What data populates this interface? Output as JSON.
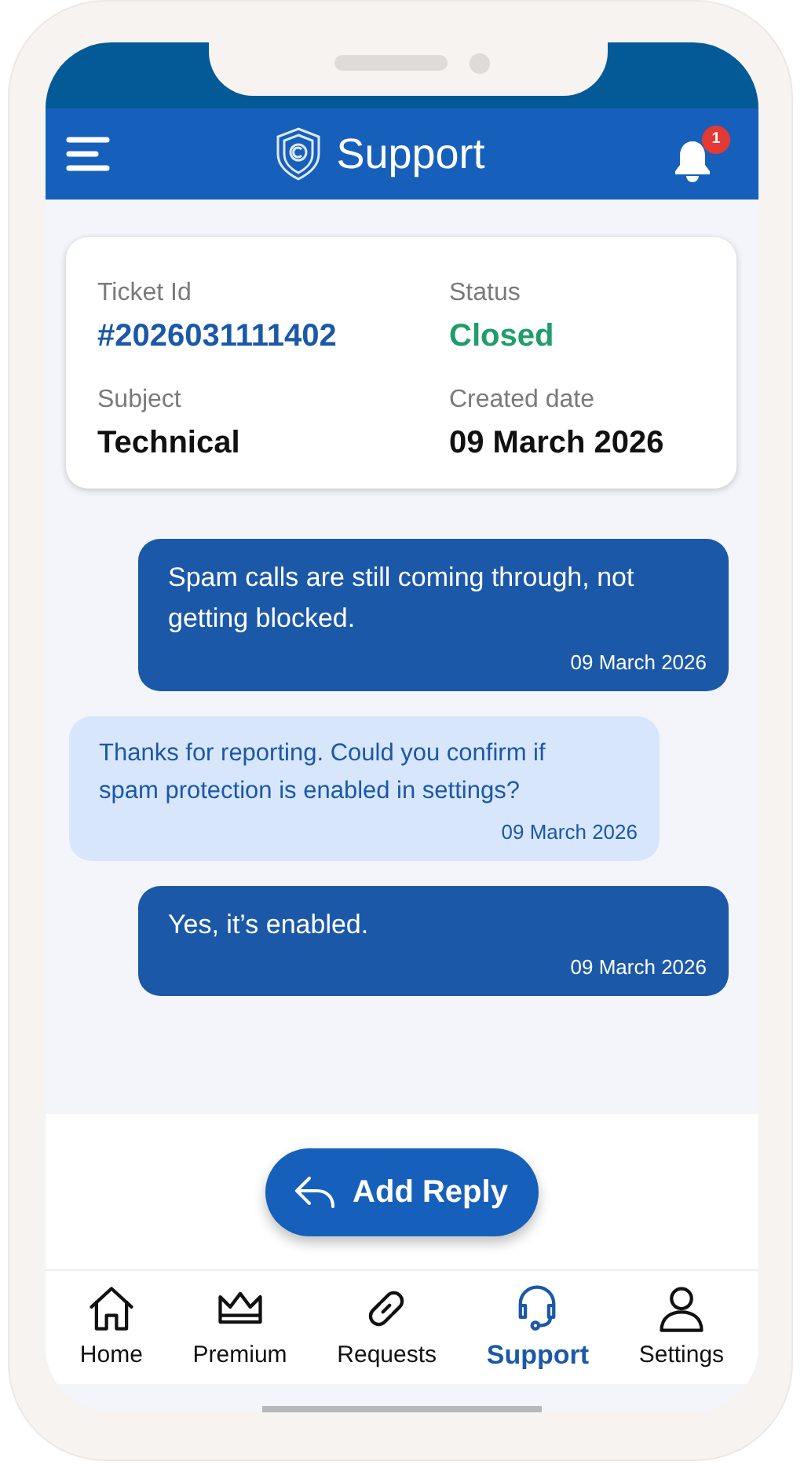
{
  "header": {
    "title": "Support",
    "notification_count": "1"
  },
  "ticket": {
    "fields": [
      {
        "label": "Ticket Id",
        "value": "#2026031111402",
        "kind": "id"
      },
      {
        "label": "Status",
        "value": "Closed",
        "kind": "status"
      },
      {
        "label": "Subject",
        "value": "Technical",
        "kind": "plain"
      },
      {
        "label": "Created date",
        "value": "09 March 2026",
        "kind": "plain"
      }
    ]
  },
  "messages": [
    {
      "kind": "sent",
      "text": "Spam calls are still coming through, not getting blocked.",
      "date": "09 March 2026"
    },
    {
      "kind": "received",
      "text": "Thanks for reporting. Could you confirm if spam protection is enabled in settings?",
      "date": "09 March 2026"
    },
    {
      "kind": "sent",
      "text": "Yes, it’s enabled.",
      "date": "09 March 2026"
    }
  ],
  "add_reply": {
    "label": "Add Reply"
  },
  "nav": [
    {
      "label": "Home",
      "selected": false
    },
    {
      "label": "Premium",
      "selected": false
    },
    {
      "label": "Requests",
      "selected": false
    },
    {
      "label": "Support",
      "selected": true
    },
    {
      "label": "Settings",
      "selected": false
    }
  ]
}
